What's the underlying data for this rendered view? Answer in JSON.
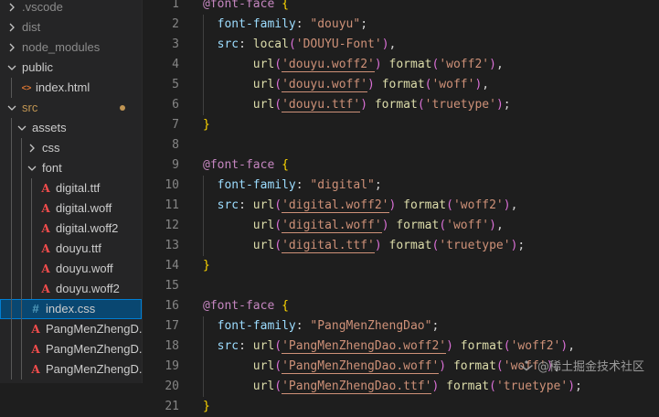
{
  "explorer": {
    "items": [
      {
        "label": ".vscode",
        "kind": "folder-collapsed",
        "indent": 0,
        "style": "dim"
      },
      {
        "label": "dist",
        "kind": "folder-collapsed",
        "indent": 0,
        "style": "dim"
      },
      {
        "label": "node_modules",
        "kind": "folder-collapsed",
        "indent": 0,
        "style": "dim"
      },
      {
        "label": "public",
        "kind": "folder-expanded",
        "indent": 0,
        "style": "normal"
      },
      {
        "label": "index.html",
        "kind": "html-file",
        "indent": 1,
        "style": "normal"
      },
      {
        "label": "src",
        "kind": "folder-expanded",
        "indent": 0,
        "style": "normal",
        "modified": true
      },
      {
        "label": "assets",
        "kind": "folder-expanded",
        "indent": 1,
        "style": "normal"
      },
      {
        "label": "css",
        "kind": "folder-collapsed",
        "indent": 2,
        "style": "normal"
      },
      {
        "label": "font",
        "kind": "folder-expanded",
        "indent": 2,
        "style": "normal"
      },
      {
        "label": "digital.ttf",
        "kind": "font-file",
        "indent": 3,
        "style": "normal"
      },
      {
        "label": "digital.woff",
        "kind": "font-file",
        "indent": 3,
        "style": "normal"
      },
      {
        "label": "digital.woff2",
        "kind": "font-file",
        "indent": 3,
        "style": "normal"
      },
      {
        "label": "douyu.ttf",
        "kind": "font-file",
        "indent": 3,
        "style": "normal"
      },
      {
        "label": "douyu.woff",
        "kind": "font-file",
        "indent": 3,
        "style": "normal"
      },
      {
        "label": "douyu.woff2",
        "kind": "font-file",
        "indent": 3,
        "style": "normal"
      },
      {
        "label": "index.css",
        "kind": "css-file",
        "indent": 2,
        "style": "normal",
        "selected": true
      },
      {
        "label": "PangMenZhengD...",
        "kind": "font-file",
        "indent": 2,
        "style": "normal"
      },
      {
        "label": "PangMenZhengD...",
        "kind": "font-file",
        "indent": 2,
        "style": "normal"
      },
      {
        "label": "PangMenZhengD...",
        "kind": "font-file",
        "indent": 2,
        "style": "normal"
      }
    ]
  },
  "editor": {
    "lines": [
      {
        "n": "1",
        "tokens": [
          [
            "at",
            "@font-face"
          ],
          [
            "plain",
            " "
          ],
          [
            "br1",
            "{"
          ]
        ]
      },
      {
        "n": "2",
        "tokens": [
          [
            "plain",
            "  "
          ],
          [
            "prop",
            "font-family"
          ],
          [
            "plain",
            ": "
          ],
          [
            "str",
            "\"douyu\""
          ],
          [
            "plain",
            ";"
          ]
        ]
      },
      {
        "n": "3",
        "tokens": [
          [
            "plain",
            "  "
          ],
          [
            "prop",
            "src"
          ],
          [
            "plain",
            ": "
          ],
          [
            "fn",
            "local"
          ],
          [
            "br2",
            "("
          ],
          [
            "str",
            "'DOUYU-Font'"
          ],
          [
            "br2",
            ")"
          ],
          [
            "plain",
            ","
          ]
        ]
      },
      {
        "n": "4",
        "tokens": [
          [
            "plain",
            "       "
          ],
          [
            "fn",
            "url"
          ],
          [
            "br2",
            "("
          ],
          [
            "strU",
            "'douyu.woff2'"
          ],
          [
            "br2",
            ")"
          ],
          [
            "plain",
            " "
          ],
          [
            "fn",
            "format"
          ],
          [
            "br2",
            "("
          ],
          [
            "str",
            "'woff2'"
          ],
          [
            "br2",
            ")"
          ],
          [
            "plain",
            ","
          ]
        ]
      },
      {
        "n": "5",
        "tokens": [
          [
            "plain",
            "       "
          ],
          [
            "fn",
            "url"
          ],
          [
            "br2",
            "("
          ],
          [
            "strU",
            "'douyu.woff'"
          ],
          [
            "br2",
            ")"
          ],
          [
            "plain",
            " "
          ],
          [
            "fn",
            "format"
          ],
          [
            "br2",
            "("
          ],
          [
            "str",
            "'woff'"
          ],
          [
            "br2",
            ")"
          ],
          [
            "plain",
            ","
          ]
        ]
      },
      {
        "n": "6",
        "tokens": [
          [
            "plain",
            "       "
          ],
          [
            "fn",
            "url"
          ],
          [
            "br2",
            "("
          ],
          [
            "strU",
            "'douyu.ttf'"
          ],
          [
            "br2",
            ")"
          ],
          [
            "plain",
            " "
          ],
          [
            "fn",
            "format"
          ],
          [
            "br2",
            "("
          ],
          [
            "str",
            "'truetype'"
          ],
          [
            "br2",
            ")"
          ],
          [
            "plain",
            ";"
          ]
        ]
      },
      {
        "n": "7",
        "tokens": [
          [
            "br1",
            "}"
          ]
        ]
      },
      {
        "n": "8",
        "tokens": []
      },
      {
        "n": "9",
        "tokens": [
          [
            "at",
            "@font-face"
          ],
          [
            "plain",
            " "
          ],
          [
            "br1",
            "{"
          ]
        ]
      },
      {
        "n": "10",
        "tokens": [
          [
            "plain",
            "  "
          ],
          [
            "prop",
            "font-family"
          ],
          [
            "plain",
            ": "
          ],
          [
            "str",
            "\"digital\""
          ],
          [
            "plain",
            ";"
          ]
        ]
      },
      {
        "n": "11",
        "tokens": [
          [
            "plain",
            "  "
          ],
          [
            "prop",
            "src"
          ],
          [
            "plain",
            ": "
          ],
          [
            "fn",
            "url"
          ],
          [
            "br2",
            "("
          ],
          [
            "strU",
            "'digital.woff2'"
          ],
          [
            "br2",
            ")"
          ],
          [
            "plain",
            " "
          ],
          [
            "fn",
            "format"
          ],
          [
            "br2",
            "("
          ],
          [
            "str",
            "'woff2'"
          ],
          [
            "br2",
            ")"
          ],
          [
            "plain",
            ","
          ]
        ]
      },
      {
        "n": "12",
        "tokens": [
          [
            "plain",
            "       "
          ],
          [
            "fn",
            "url"
          ],
          [
            "br2",
            "("
          ],
          [
            "strU",
            "'digital.woff'"
          ],
          [
            "br2",
            ")"
          ],
          [
            "plain",
            " "
          ],
          [
            "fn",
            "format"
          ],
          [
            "br2",
            "("
          ],
          [
            "str",
            "'woff'"
          ],
          [
            "br2",
            ")"
          ],
          [
            "plain",
            ","
          ]
        ]
      },
      {
        "n": "13",
        "tokens": [
          [
            "plain",
            "       "
          ],
          [
            "fn",
            "url"
          ],
          [
            "br2",
            "("
          ],
          [
            "strU",
            "'digital.ttf'"
          ],
          [
            "br2",
            ")"
          ],
          [
            "plain",
            " "
          ],
          [
            "fn",
            "format"
          ],
          [
            "br2",
            "("
          ],
          [
            "str",
            "'truetype'"
          ],
          [
            "br2",
            ")"
          ],
          [
            "plain",
            ";"
          ]
        ]
      },
      {
        "n": "14",
        "tokens": [
          [
            "br1",
            "}"
          ]
        ]
      },
      {
        "n": "15",
        "tokens": []
      },
      {
        "n": "16",
        "tokens": [
          [
            "at",
            "@font-face"
          ],
          [
            "plain",
            " "
          ],
          [
            "br1",
            "{"
          ]
        ]
      },
      {
        "n": "17",
        "tokens": [
          [
            "plain",
            "  "
          ],
          [
            "prop",
            "font-family"
          ],
          [
            "plain",
            ": "
          ],
          [
            "str",
            "\"PangMenZhengDao\""
          ],
          [
            "plain",
            ";"
          ]
        ]
      },
      {
        "n": "18",
        "tokens": [
          [
            "plain",
            "  "
          ],
          [
            "prop",
            "src"
          ],
          [
            "plain",
            ": "
          ],
          [
            "fn",
            "url"
          ],
          [
            "br2",
            "("
          ],
          [
            "strU",
            "'PangMenZhengDao.woff2'"
          ],
          [
            "br2",
            ")"
          ],
          [
            "plain",
            " "
          ],
          [
            "fn",
            "format"
          ],
          [
            "br2",
            "("
          ],
          [
            "str",
            "'woff2'"
          ],
          [
            "br2",
            ")"
          ],
          [
            "plain",
            ","
          ]
        ]
      },
      {
        "n": "19",
        "tokens": [
          [
            "plain",
            "       "
          ],
          [
            "fn",
            "url"
          ],
          [
            "br2",
            "("
          ],
          [
            "strU",
            "'PangMenZhengDao.woff'"
          ],
          [
            "br2",
            ")"
          ],
          [
            "plain",
            " "
          ],
          [
            "fn",
            "format"
          ],
          [
            "br2",
            "("
          ],
          [
            "str",
            "'woff'"
          ],
          [
            "br2",
            ")"
          ],
          [
            "plain",
            ","
          ]
        ]
      },
      {
        "n": "20",
        "tokens": [
          [
            "plain",
            "       "
          ],
          [
            "fn",
            "url"
          ],
          [
            "br2",
            "("
          ],
          [
            "strU",
            "'PangMenZhengDao.ttf'"
          ],
          [
            "br2",
            ")"
          ],
          [
            "plain",
            " "
          ],
          [
            "fn",
            "format"
          ],
          [
            "br2",
            "("
          ],
          [
            "str",
            "'truetype'"
          ],
          [
            "br2",
            ")"
          ],
          [
            "plain",
            ";"
          ]
        ]
      },
      {
        "n": "21",
        "tokens": [
          [
            "br1",
            "}"
          ]
        ]
      }
    ]
  },
  "watermark": {
    "text": "@稀土掘金技术社区"
  },
  "colors": {
    "background": "#1e1e1e",
    "sidebar": "#252526",
    "selection": "#094771",
    "at_rule": "#c586c0",
    "property": "#9cdcfe",
    "string": "#ce9178",
    "function": "#dcdcaa",
    "bracket_1": "#ffd700",
    "bracket_2": "#da70d6",
    "font_file_icon": "#f14c4c",
    "css_file_icon": "#519aba",
    "html_file_icon": "#e37933",
    "modified_dot": "#c09553"
  }
}
